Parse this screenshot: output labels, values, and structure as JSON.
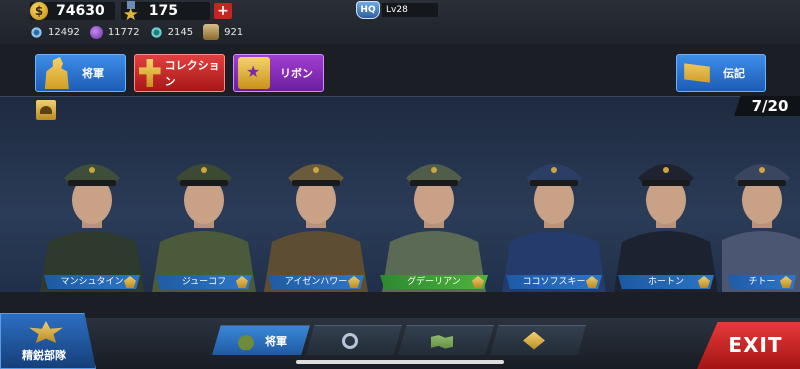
{
  "resources": {
    "gold": "74630",
    "medals": "175",
    "plus": "+",
    "gear": "12492",
    "crystal": "11772",
    "steel": "2145",
    "badge": "921"
  },
  "hq": {
    "badge": "HQ",
    "level": "Lv28"
  },
  "menu": {
    "general": "将軍",
    "collection": "コレクション",
    "ribbon": "リボン",
    "biography": "伝記"
  },
  "roster_count": "7/20",
  "generals": [
    {
      "name": "マンシュタイン",
      "selected": false,
      "cap": "#3f4d3b",
      "coat": "#2f3a2f"
    },
    {
      "name": "ジューコフ",
      "selected": false,
      "cap": "#3c4a33",
      "coat": "#4a5a3a"
    },
    {
      "name": "アイゼンハワー",
      "selected": false,
      "cap": "#6a5b3a",
      "coat": "#5d4e33"
    },
    {
      "name": "グデーリアン",
      "selected": true,
      "cap": "#4f5d4a",
      "coat": "#5b6a55"
    },
    {
      "name": "ココソフスキー",
      "selected": false,
      "cap": "#2b3f66",
      "coat": "#243b6b"
    },
    {
      "name": "ホートン",
      "selected": false,
      "cap": "#1f2330",
      "coat": "#1c2230"
    },
    {
      "name": "チトー",
      "selected": false,
      "cap": "#3a4560",
      "coat": "#4a5672"
    }
  ],
  "bottom": {
    "elite": "精鋭部隊",
    "tab_general": "将軍",
    "exit": "EXIT"
  },
  "colors": {
    "accent_blue": "#2d78cd",
    "selected_green": "#4fb23d",
    "exit_red": "#d42828"
  }
}
